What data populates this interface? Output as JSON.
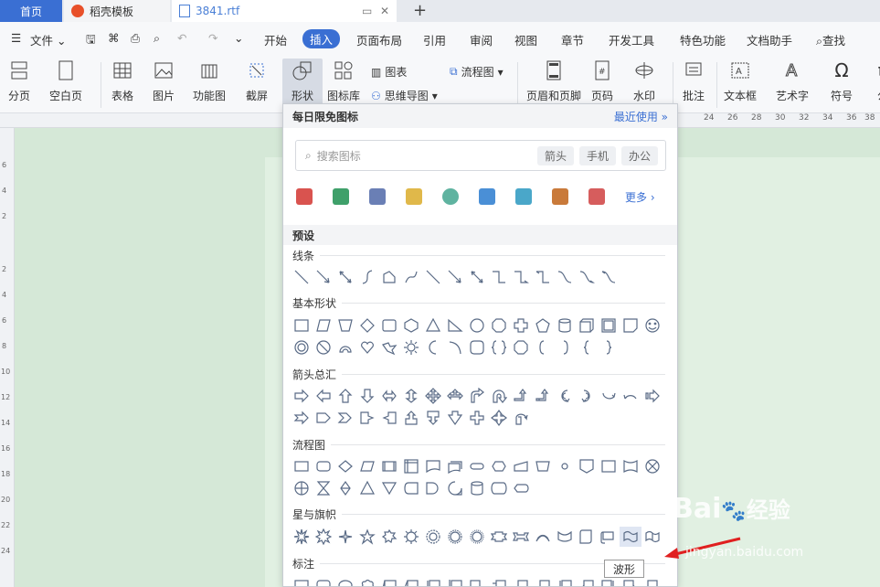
{
  "tabs": [
    {
      "label": "首页"
    },
    {
      "label": "稻壳模板"
    },
    {
      "label": "3841.rtf"
    }
  ],
  "menu": {
    "file": "文件",
    "items": [
      "开始",
      "插入",
      "页面布局",
      "引用",
      "审阅",
      "视图",
      "章节",
      "开发工具",
      "特色功能",
      "文档助手"
    ],
    "search": "查找"
  },
  "toolbar": {
    "fenye": "分页",
    "kongbaiye": "空白页",
    "biaoge": "表格",
    "tupian": "图片",
    "gongnengtu": "功能图",
    "jieping": "截屏",
    "xingzhuang": "形状",
    "tubiaoku": "图标库",
    "tubiao": "图表",
    "siweidaotu": "思维导图",
    "liuchengtu": "流程图",
    "yemei": "页眉和页脚",
    "yema": "页码",
    "shuiyin": "水印",
    "pizhu": "批注",
    "wenbenkuang": "文本框",
    "yishuzi": "艺术字",
    "fuhao": "符号",
    "gong": "公"
  },
  "ruler": {
    "top": [
      "24",
      "26",
      "28",
      "30",
      "32",
      "34",
      "36",
      "38"
    ],
    "left": [
      "6",
      "4",
      "2",
      "2",
      "4",
      "6",
      "8",
      "10",
      "12",
      "14",
      "16",
      "18",
      "20",
      "22",
      "24"
    ]
  },
  "panel": {
    "title": "每日限免图标",
    "recent": "最近使用",
    "search_placeholder": "搜索图标",
    "chips": [
      "箭头",
      "手机",
      "办公"
    ],
    "more": "更多",
    "preset": "预设",
    "categories": {
      "lines": "线条",
      "basic": "基本形状",
      "arrows": "箭头总汇",
      "flow": "流程图",
      "stars": "星与旗帜",
      "callouts": "标注"
    }
  },
  "tooltip": "波形",
  "watermark": {
    "brand": "Bai",
    "brand2": "经验",
    "url": "jingyan.baidu.com"
  },
  "colors": {
    "accent": "#3a6fd3",
    "canvas": "#d5e8d7",
    "shape_stroke": "#5a6b86"
  }
}
